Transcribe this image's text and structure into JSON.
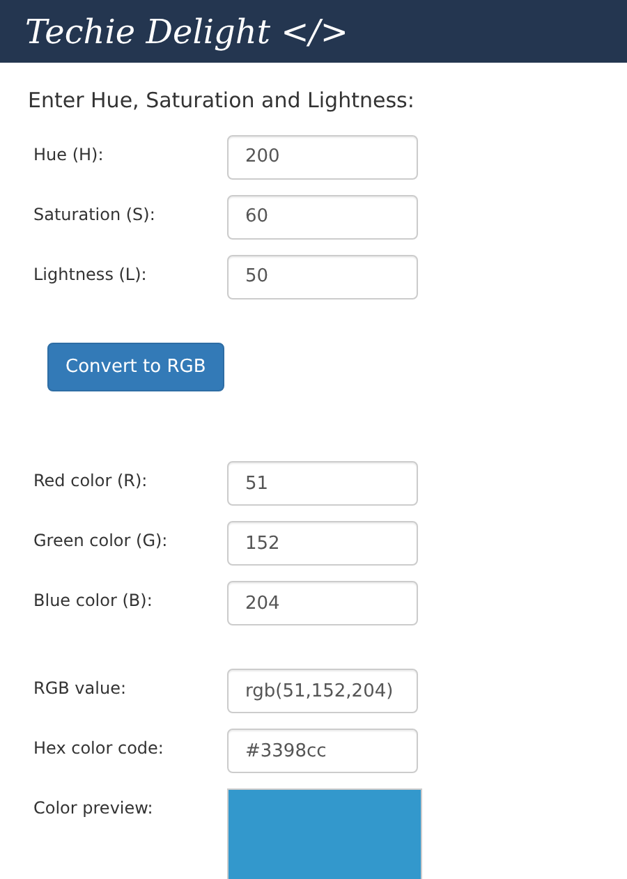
{
  "header": {
    "logo": "Techie Delight </>"
  },
  "heading": "Enter Hue, Saturation and Lightness:",
  "input_fields": [
    {
      "label": "Hue (H):",
      "value": "200"
    },
    {
      "label": "Saturation (S):",
      "value": "60"
    },
    {
      "label": "Lightness (L):",
      "value": "50"
    }
  ],
  "convert_button": "Convert to RGB",
  "rgb_fields": [
    {
      "label": "Red color (R):",
      "value": "51"
    },
    {
      "label": "Green color (G):",
      "value": "152"
    },
    {
      "label": "Blue color (B):",
      "value": "204"
    }
  ],
  "results": [
    {
      "kind": "text",
      "label": "RGB value:",
      "value": "rgb(51,152,204)"
    },
    {
      "kind": "text",
      "label": "Hex color code:",
      "value": "#3398cc"
    },
    {
      "kind": "swatch",
      "label": "Color preview:",
      "color": "#3398cc"
    }
  ]
}
